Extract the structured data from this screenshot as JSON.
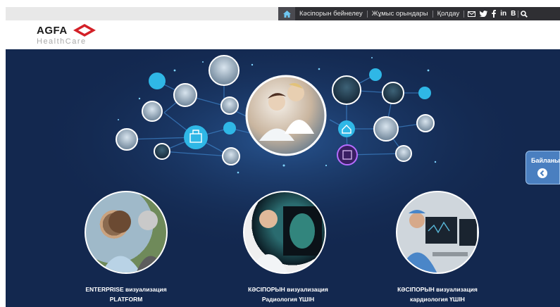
{
  "topnav": {
    "items": [
      "Кәсіпорын бейнелеу",
      "Жұмыс орындары",
      "Қолдау"
    ],
    "social": {
      "linkedin": "in",
      "blog": "B"
    }
  },
  "header": {
    "brand": "AGFA",
    "sub": "HealthCare",
    "diamond_text": "Agfa"
  },
  "tiles": [
    {
      "line1": "ENTERPRISE визуализация",
      "line2": "PLATFORM"
    },
    {
      "line1": "КӘСІПОРЫН визуализация",
      "line2": "Радиология ҮШІН"
    },
    {
      "line1": "КӘСІПОРЫН визуализация",
      "line2": "кардиология ҮШІН"
    }
  ],
  "contact": {
    "label": "Байланыс"
  },
  "colors": {
    "hero_bg": "#13284f",
    "accent_cyan": "#2fb7e6",
    "topnav_bg": "#2f2f33",
    "contact_bg": "#4a7fc0",
    "brand_red": "#d32027"
  }
}
